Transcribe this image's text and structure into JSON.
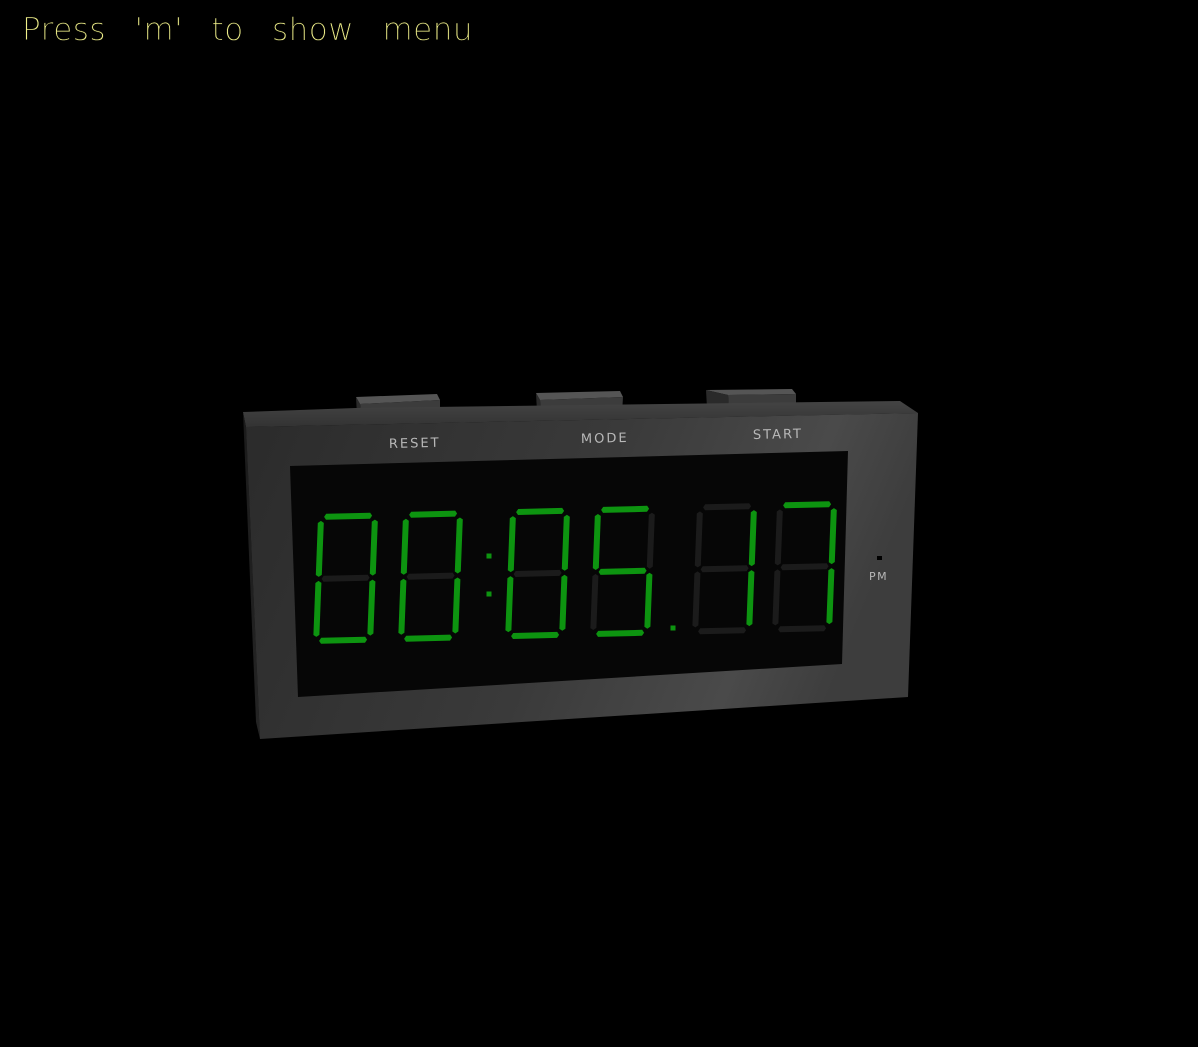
{
  "hint_text": "Press  'm'  to  show  menu",
  "clock": {
    "digits": [
      "0",
      "0",
      "0",
      "5",
      "1",
      "7"
    ],
    "colon_1": true,
    "colon_2": true,
    "decimal_point": true,
    "pm_indicator": "PM",
    "lit_color": "#0d9410",
    "unlit_color": "#1b1b1b"
  },
  "buttons": {
    "reset_label": "RESET",
    "mode_label": "MODE",
    "start_label": "START"
  }
}
